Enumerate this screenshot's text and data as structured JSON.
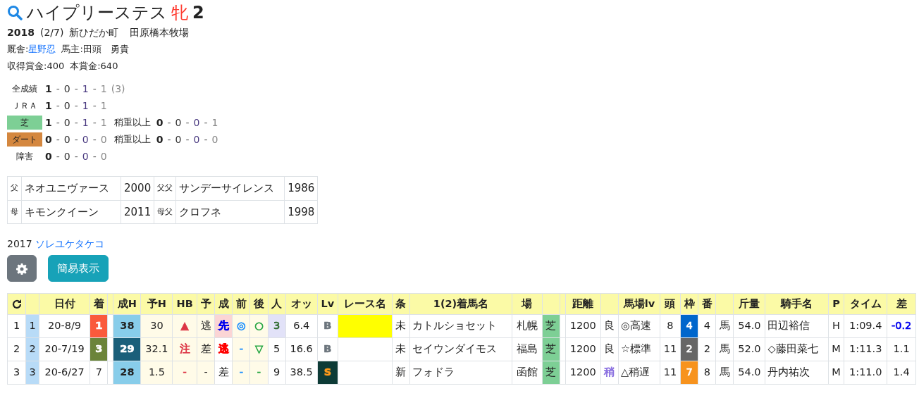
{
  "horse": {
    "name": "ハイプリーステス",
    "sex": "牝",
    "age": "2"
  },
  "birth": {
    "year": "2018",
    "date": "(2/7)",
    "place": "新ひだか町",
    "breeder": "田原橋本牧場"
  },
  "stable": {
    "label": "厩舎:",
    "trainer": "星野忍",
    "owner_label": "馬主:",
    "owner": "田頭　勇貴"
  },
  "prize": {
    "earned": "収得賞金:400",
    "total": "本賞金:640"
  },
  "records": [
    {
      "label": "全成績",
      "counts": [
        "1",
        "-",
        "0",
        "-",
        "1",
        "-",
        "1"
      ],
      "total": "(3)"
    },
    {
      "label": "ＪＲＡ",
      "counts": [
        "1",
        "-",
        "0",
        "-",
        "1",
        "-",
        "1"
      ]
    },
    {
      "label": "芝",
      "color": "#7dcf95",
      "counts": [
        "1",
        "-",
        "0",
        "-",
        "1",
        "-",
        "1"
      ],
      "sub": {
        "label": "稍重以上",
        "counts": [
          "0",
          "-",
          "0",
          "-",
          "0",
          "-",
          "1"
        ]
      }
    },
    {
      "label": "ダート",
      "color": "#d4873f",
      "counts": [
        "0",
        "-",
        "0",
        "-",
        "0",
        "-",
        "0"
      ],
      "sub": {
        "label": "稍重以上",
        "counts": [
          "0",
          "-",
          "0",
          "-",
          "0",
          "-",
          "0"
        ]
      }
    },
    {
      "label": "障害",
      "counts": [
        "0",
        "-",
        "0",
        "-",
        "0",
        "-",
        "0"
      ]
    }
  ],
  "pedigree": [
    [
      "父",
      "ネオユニヴァース",
      "2000",
      "父父",
      "サンデーサイレンス",
      "1986"
    ],
    [
      "母",
      "キモンクイーン",
      "2011",
      "母父",
      "クロフネ",
      "1998"
    ]
  ],
  "sibling": {
    "year": "2017",
    "name": "ソレユケタケコ"
  },
  "buttons": [
    {
      "kind": "settings"
    },
    {
      "kind": "text",
      "label": "簡易表示"
    }
  ],
  "table": {
    "columns": [
      {
        "kind": "refresh"
      },
      null,
      "日付",
      "着",
      null,
      "成H",
      "予H",
      "HB",
      "予",
      "成",
      "前",
      "後",
      "人",
      "オッ",
      "Lv",
      "レース名",
      "条",
      "1(2)着馬名",
      "場",
      null,
      null,
      "距離",
      null,
      "馬場lv",
      "頭",
      "枠",
      "番",
      null,
      "斤量",
      "騎手名",
      "P",
      "タイム",
      "差"
    ],
    "rows": [
      {
        "cells": [
          "1",
          {
            "text": "1",
            "color": "#b8dbf7"
          },
          "20-8/9",
          {
            "text": "1",
            "color": "#fa5a3c",
            "ink": {
              "color": "#ffffff"
            },
            "bold": true
          },
          null,
          {
            "text": "38",
            "color": "#88cdea",
            "bold": true
          },
          {
            "text": "30",
            "color": "#fffbe8"
          },
          {
            "text": "▲",
            "color": "#fffbe8",
            "ink": {
              "color": "#dc3545"
            }
          },
          {
            "text": "逃",
            "color": "#fffbe8"
          },
          {
            "text": "先",
            "color": "#fbd5d5",
            "ink": {
              "color": "#0000ee"
            },
            "bold": true
          },
          {
            "text": "◎",
            "color": "#fffbe8",
            "ink": {
              "color": "#1e90ff"
            }
          },
          {
            "text": "○",
            "color": "#fffbe8",
            "ink": {
              "color": "#28a745"
            }
          },
          {
            "text": "3",
            "color": "#e2e2f8",
            "ink": {
              "color": "#2e6b2e"
            }
          },
          "6.4",
          {
            "text": "B",
            "ink": {
              "color": "#6c757d"
            },
            "bold": true
          },
          {
            "color": "#ffff00"
          },
          "未",
          "カトルショセット",
          "札幌",
          {
            "text": "芝",
            "color": "#7dcf95"
          },
          null,
          "1200",
          "良",
          "◎高速",
          "8",
          {
            "text": "4",
            "color": "#0066cc",
            "ink": {
              "color": "#ffffff"
            }
          },
          "4",
          "馬",
          "54.0",
          "田辺裕信",
          "H",
          "1:09.4",
          {
            "text": "-0.2",
            "ink": {
              "color": "#0000ee"
            }
          }
        ]
      },
      {
        "cells": [
          "2",
          {
            "text": "2",
            "color": "#b8dbf7"
          },
          "20-7/19",
          {
            "text": "3",
            "color": "#6b843a",
            "ink": {
              "color": "#ffffff"
            },
            "bold": true
          },
          null,
          {
            "text": "29",
            "color": "#1a5f7a",
            "ink": {
              "color": "#ffffff"
            },
            "bold": true
          },
          {
            "text": "32.1",
            "color": "#fffbe8"
          },
          {
            "text": "注",
            "color": "#fffbe8",
            "ink": {
              "color": "#dc3545"
            }
          },
          {
            "text": "差",
            "color": "#fffbe8"
          },
          {
            "text": "逃",
            "ink": {
              "color": "#ff0000"
            },
            "bold": true
          },
          {
            "text": "-",
            "color": "#fffbe8",
            "ink": {
              "color": "#1e90ff"
            }
          },
          {
            "text": "▽",
            "color": "#fffbe8",
            "ink": {
              "color": "#28a745"
            }
          },
          "5",
          "16.6",
          {
            "text": "B",
            "ink": {
              "color": "#6c757d"
            },
            "bold": true
          },
          null,
          "未",
          "セイウンダイモス",
          "福島",
          {
            "text": "芝",
            "color": "#7dcf95"
          },
          null,
          "1200",
          "良",
          "☆標準",
          "11",
          {
            "text": "2",
            "color": "#666666",
            "ink": {
              "color": "#ffffff"
            }
          },
          "2",
          "馬",
          "52.0",
          "◇藤田菜七",
          "M",
          "1:11.3",
          "1.1"
        ]
      },
      {
        "cells": [
          "3",
          {
            "text": "3",
            "color": "#b8dbf7"
          },
          "20-6/27",
          "7",
          null,
          {
            "text": "28",
            "color": "#88cdea",
            "bold": true
          },
          {
            "text": "1.5",
            "color": "#fffbe8"
          },
          {
            "text": "-",
            "color": "#fffbe8",
            "ink": {
              "color": "#dc3545"
            }
          },
          {
            "text": "-",
            "color": "#fffbe8"
          },
          "差",
          {
            "text": "-",
            "color": "#fffbe8",
            "ink": {
              "color": "#1e90ff"
            }
          },
          {
            "text": "-",
            "color": "#fffbe8",
            "ink": {
              "color": "#28a745"
            }
          },
          "9",
          "38.5",
          {
            "text": "S",
            "color": "#0d3b36",
            "ink": {
              "color": "#ff9a1a"
            },
            "bold": true
          },
          null,
          "新",
          "フォドラ",
          "函館",
          {
            "text": "芝",
            "color": "#7dcf95"
          },
          null,
          "1200",
          {
            "text": "稍",
            "ink": {
              "color": "#8a6fe0"
            }
          },
          "△稍遅",
          "11",
          {
            "text": "7",
            "color": "#f7931e",
            "ink": {
              "color": "#ffffff"
            }
          },
          "8",
          "馬",
          "54.0",
          "丹内祐次",
          "M",
          "1:11.0",
          "1.4"
        ]
      }
    ]
  }
}
